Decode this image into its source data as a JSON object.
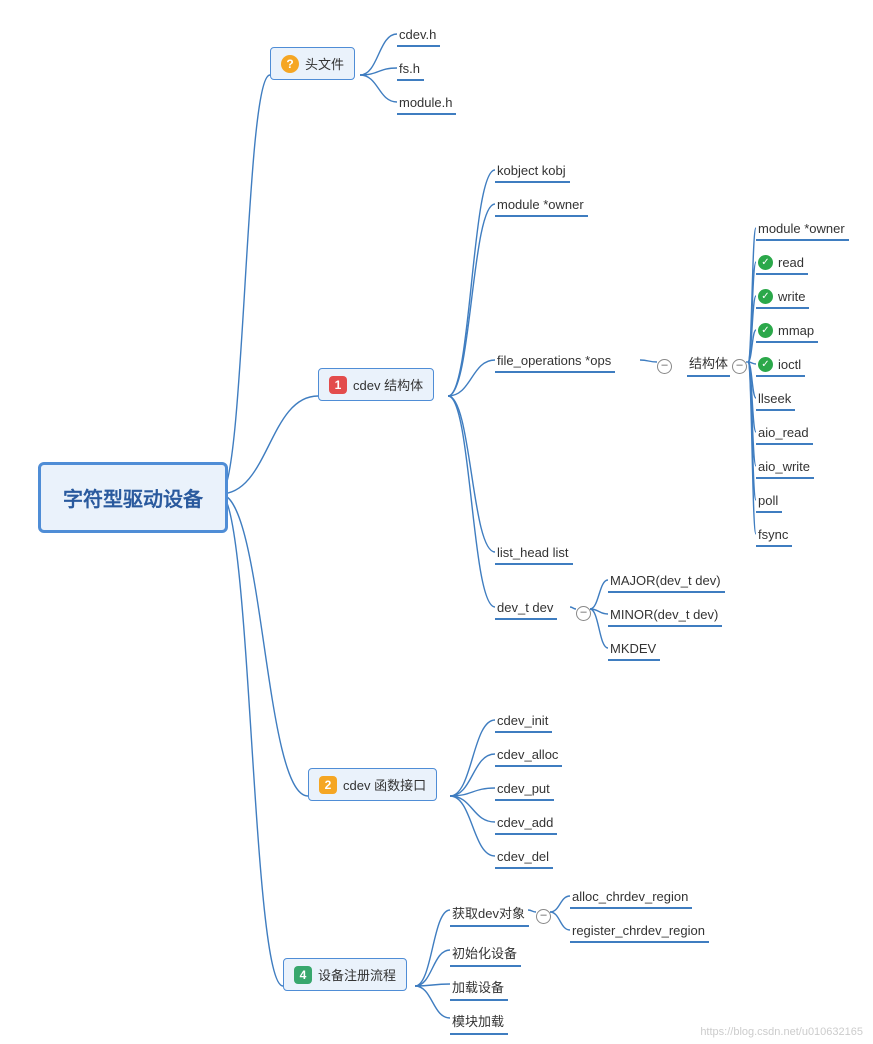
{
  "chart_data": {
    "type": "mindmap",
    "root": "字符型驱动设备",
    "children": [
      {
        "label": "头文件",
        "badge": "?",
        "children": [
          "cdev.h",
          "fs.h",
          "module.h"
        ]
      },
      {
        "label": "cdev 结构体",
        "badge": "1",
        "children": [
          "kobject kobj",
          "module *owner",
          {
            "label": "file_operations *ops",
            "children": [
              {
                "label": "结构体",
                "children": [
                  "module *owner",
                  {
                    "label": "read",
                    "check": true
                  },
                  {
                    "label": "write",
                    "check": true
                  },
                  {
                    "label": "mmap",
                    "check": true
                  },
                  {
                    "label": "ioctl",
                    "check": true
                  },
                  "llseek",
                  "aio_read",
                  "aio_write",
                  "poll",
                  "fsync"
                ]
              }
            ]
          },
          "list_head list",
          {
            "label": "dev_t dev",
            "children": [
              "MAJOR(dev_t dev)",
              "MINOR(dev_t dev)",
              "MKDEV"
            ]
          }
        ]
      },
      {
        "label": "cdev 函数接口",
        "badge": "2",
        "children": [
          "cdev_init",
          "cdev_alloc",
          "cdev_put",
          "cdev_add",
          "cdev_del"
        ]
      },
      {
        "label": "设备注册流程",
        "badge": "4",
        "children": [
          {
            "label": "获取dev对象",
            "children": [
              "alloc_chrdev_region",
              "register_chrdev_region"
            ]
          },
          "初始化设备",
          "加载设备",
          "模块加载"
        ]
      }
    ]
  },
  "root": "字符型驱动设备",
  "topic1": {
    "label": "头文件",
    "badge": "?"
  },
  "topic2": {
    "label": "cdev 结构体",
    "badge": "1"
  },
  "topic3": {
    "label": "cdev 函数接口",
    "badge": "2"
  },
  "topic4": {
    "label": "设备注册流程",
    "badge": "4"
  },
  "t1_children": [
    "cdev.h",
    "fs.h",
    "module.h"
  ],
  "t2_children": [
    "kobject kobj",
    "module *owner",
    "file_operations *ops",
    "list_head list",
    "dev_t dev"
  ],
  "fops_mid": "结构体",
  "fops_children": [
    "module *owner",
    "read",
    "write",
    "mmap",
    "ioctl",
    "llseek",
    "aio_read",
    "aio_write",
    "poll",
    "fsync"
  ],
  "fops_checks": [
    false,
    true,
    true,
    true,
    true,
    false,
    false,
    false,
    false,
    false
  ],
  "devt_children": [
    "MAJOR(dev_t dev)",
    "MINOR(dev_t dev)",
    "MKDEV"
  ],
  "t3_children": [
    "cdev_init",
    "cdev_alloc",
    "cdev_put",
    "cdev_add",
    "cdev_del"
  ],
  "t4_children": [
    "获取dev对象",
    "初始化设备",
    "加载设备",
    "模块加载"
  ],
  "t4a_children": [
    "alloc_chrdev_region",
    "register_chrdev_region"
  ],
  "watermark": "https://blog.csdn.net/u010632165",
  "toggle": "–"
}
